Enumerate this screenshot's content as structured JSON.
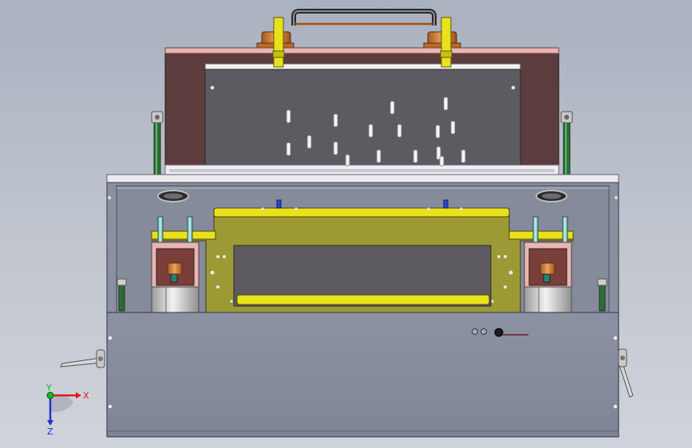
{
  "viewport": {
    "background_top": "#aab1bf",
    "background_bottom": "#cfd3da"
  },
  "colors": {
    "frame_gray": "#7d8493",
    "panel_gray": "#8a90a2",
    "dark_panel": "#5b585c",
    "brown": "#5b3b3b",
    "yellow": "#e9e21a",
    "olive": "#9f9a33",
    "pink": "#e7b6b3",
    "orange": "#c8783a",
    "silver": "#dcdcdc",
    "teal": "#62b6b3",
    "blue_pin": "#2b44d6",
    "axis_x": "#e01a1a",
    "axis_y": "#18b418",
    "axis_z": "#2233c8"
  },
  "triad": {
    "x_label": "X",
    "y_label": "Y",
    "z_label": "Z"
  }
}
